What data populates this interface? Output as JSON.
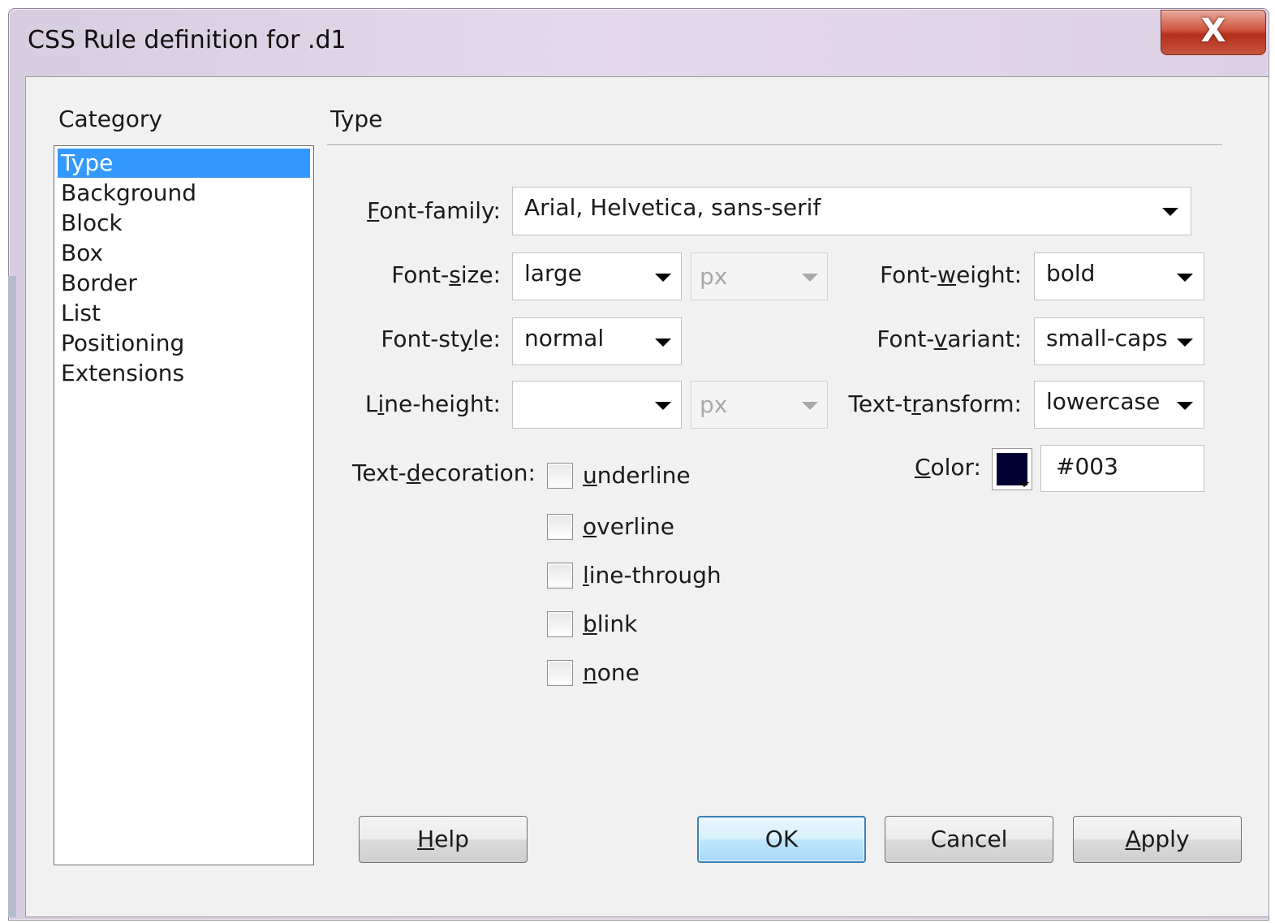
{
  "window": {
    "title": "CSS Rule definition for .d1",
    "close_glyph": "X"
  },
  "category": {
    "header": "Category",
    "items": [
      "Type",
      "Background",
      "Block",
      "Box",
      "Border",
      "List",
      "Positioning",
      "Extensions"
    ],
    "selected": "Type"
  },
  "panel": {
    "title": "Type"
  },
  "fields": {
    "font_family": {
      "label_pre": "",
      "label_key": "F",
      "label_post": "ont-family:",
      "value": "Arial, Helvetica, sans-serif"
    },
    "font_size": {
      "label_pre": "Font-",
      "label_key": "s",
      "label_post": "ize:",
      "value": "large",
      "unit": "px"
    },
    "font_weight": {
      "label_pre": "Font-",
      "label_key": "w",
      "label_post": "eight:",
      "value": "bold"
    },
    "font_style": {
      "label_pre": "Font-st",
      "label_key": "y",
      "label_post": "le:",
      "value": "normal"
    },
    "font_variant": {
      "label_pre": "Font-",
      "label_key": "v",
      "label_post": "ariant:",
      "value": "small-caps"
    },
    "line_height": {
      "label_pre": "L",
      "label_key": "i",
      "label_post": "ne-height:",
      "value": "",
      "unit": "px"
    },
    "text_transform": {
      "label_pre": "Text-t",
      "label_key": "r",
      "label_post": "ansform:",
      "value": "lowercase"
    },
    "color": {
      "label_pre": "",
      "label_key": "C",
      "label_post": "olor:",
      "value": "#003",
      "swatch": "#000033"
    }
  },
  "text_decoration": {
    "label_pre": "Text-",
    "label_key": "d",
    "label_post": "ecoration:",
    "options": [
      {
        "key": "u",
        "rest": "nderline",
        "checked": false
      },
      {
        "key": "o",
        "rest": "verline",
        "checked": false
      },
      {
        "key": "l",
        "rest": "ine-through",
        "checked": false
      },
      {
        "key": "b",
        "rest": "link",
        "checked": false
      },
      {
        "key": "n",
        "rest": "one",
        "checked": false
      }
    ]
  },
  "buttons": {
    "help": {
      "key": "H",
      "rest": "elp"
    },
    "ok": {
      "label": "OK"
    },
    "cancel": {
      "label": "Cancel"
    },
    "apply": {
      "key": "A",
      "rest": "pply"
    }
  }
}
